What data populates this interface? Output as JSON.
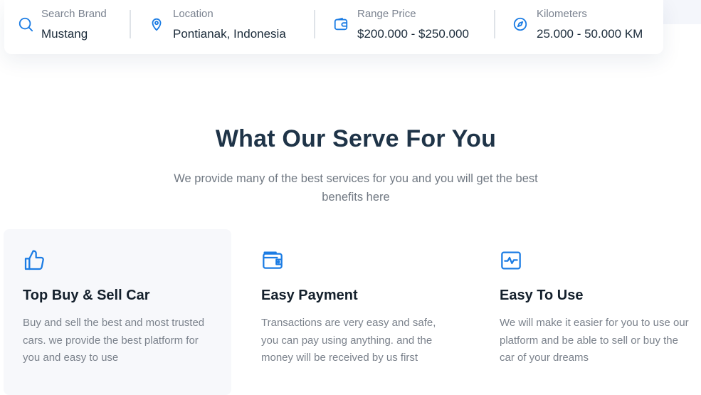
{
  "search": {
    "brand": {
      "label": "Search Brand",
      "value": "Mustang",
      "icon": "search-icon"
    },
    "location": {
      "label": "Location",
      "value": "Pontianak, Indonesia",
      "icon": "map-pin-icon"
    },
    "price": {
      "label": "Range Price",
      "value": "$200.000 - $250.000",
      "icon": "wallet-icon"
    },
    "kilometers": {
      "label": "Kilometers",
      "value": "25.000 - 50.000 KM",
      "icon": "compass-icon"
    }
  },
  "services": {
    "title": "What Our Serve For You",
    "subtitle": "We provide many of the best services for you and you will get the best benefits here",
    "cards": [
      {
        "icon": "thumbs-up-icon",
        "title": "Top Buy & Sell Car",
        "description": "Buy and sell the best and most trusted cars. we provide the best platform for you and easy to use"
      },
      {
        "icon": "wallet-icon",
        "title": "Easy Payment",
        "description": "Transactions are very easy and safe, you can pay using anything. and the money will be received by us first"
      },
      {
        "icon": "activity-icon",
        "title": "Easy To Use",
        "description": "We will make it easier for you to use our platform and be able to sell or buy the car of your dreams"
      }
    ]
  },
  "colors": {
    "accent": "#1b7ce4",
    "heading": "#1f3448",
    "text_muted": "#7b828c",
    "card_bg": "#f7f8fb"
  }
}
